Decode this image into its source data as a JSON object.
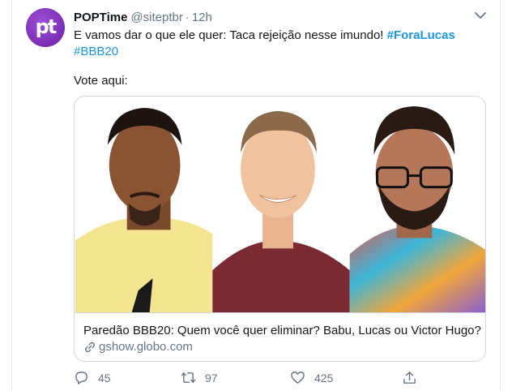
{
  "tweet": {
    "author_name": "POPTime",
    "handle": "@siteptbr",
    "separator": "·",
    "time": "12h",
    "avatar_text": "pt",
    "text_intro": "E vamos dar o que ele quer: Taca rejeição nesse imundo!",
    "hashtag_1": "#ForaLucas",
    "hashtag_2": "#BBB20",
    "vote_text": "Vote aqui:"
  },
  "card": {
    "title": "Paredão BBB20: Quem você quer eliminar? Babu, Lucas ou Victor Hugo?",
    "domain": "gshow.globo.com"
  },
  "actions": {
    "replies": "45",
    "retweets": "97",
    "likes": "425"
  },
  "icons": {
    "chevron": "chevron-down-icon",
    "link": "link-icon",
    "reply": "reply-icon",
    "retweet": "retweet-icon",
    "like": "heart-icon",
    "share": "share-icon"
  },
  "colors": {
    "accent": "#1b95e0",
    "muted": "#657786",
    "avatar": "#7b2cbf",
    "border": "#ccd6dd"
  }
}
